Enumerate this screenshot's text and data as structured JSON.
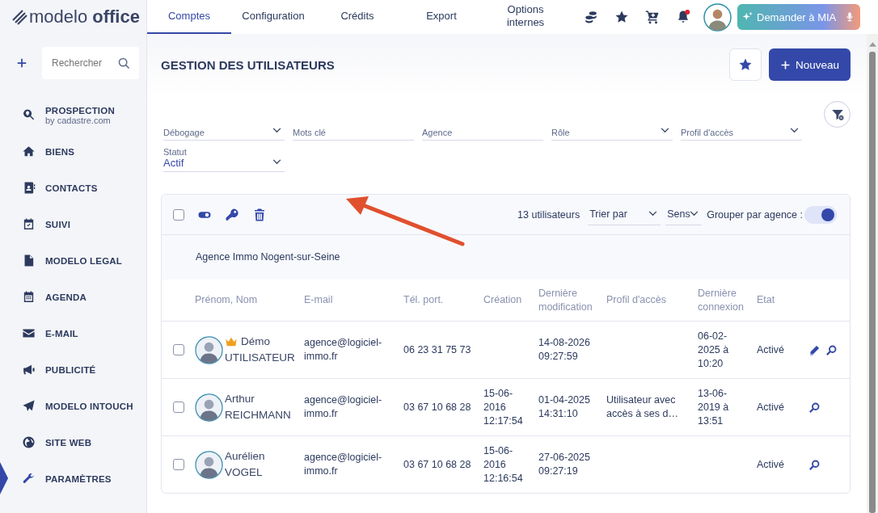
{
  "logo": {
    "text_light": "modelo",
    "text_bold": "office"
  },
  "tabs": [
    {
      "label": "Comptes",
      "selected": true
    },
    {
      "label": "Configuration",
      "selected": false
    },
    {
      "label": "Crédits",
      "selected": false
    },
    {
      "label": "Export",
      "selected": false
    },
    {
      "label": "Options internes",
      "selected": false
    }
  ],
  "notifications": {
    "unread": true
  },
  "ai_button": {
    "label": "Demander à MIA"
  },
  "sidebar": {
    "search": {
      "placeholder": "Rechercher"
    },
    "items": [
      {
        "label": "PROSPECTION",
        "sublabel": "by cadastre.com",
        "selected": false
      },
      {
        "label": "BIENS",
        "selected": false
      },
      {
        "label": "CONTACTS",
        "selected": false
      },
      {
        "label": "SUIVI",
        "selected": false
      },
      {
        "label": "MODELO LEGAL",
        "selected": false
      },
      {
        "label": "AGENDA",
        "selected": false
      },
      {
        "label": "E-MAIL",
        "selected": false
      },
      {
        "label": "PUBLICITÉ",
        "selected": false
      },
      {
        "label": "MODELO INTOUCH",
        "selected": false
      },
      {
        "label": "SITE WEB",
        "selected": false
      },
      {
        "label": "PARAMÈTRES",
        "selected": true
      }
    ]
  },
  "page": {
    "title": "GESTION DES UTILISATEURS",
    "new_button": "Nouveau"
  },
  "filters": [
    {
      "label": "Débogage",
      "kind": "select"
    },
    {
      "label": "Mots clé",
      "kind": "text"
    },
    {
      "label": "Agence",
      "kind": "text"
    },
    {
      "label": "Rôle",
      "kind": "select"
    },
    {
      "label": "Profil d'accès",
      "kind": "select"
    },
    {
      "label": "Statut",
      "kind": "select",
      "value": "Actif"
    }
  ],
  "toolbar": {
    "select_all": {
      "checked": false
    },
    "count": "13 utilisateurs",
    "sort": {
      "placeholder": "Trier par"
    },
    "direction": {
      "placeholder": "Sens"
    },
    "group_label": "Grouper par agence :",
    "group_on": true
  },
  "table": {
    "group": "Agence Immo Nogent-sur-Seine",
    "columns": [
      "Prénom, Nom",
      "E-mail",
      "Tél. port.",
      "Création",
      "Dernière modification",
      "Profil d'accès",
      "Dernière connexion",
      "Etat"
    ],
    "rows": [
      {
        "checked": false,
        "owner": true,
        "first": "Démo",
        "last": "UTILISATEUR",
        "email": "agence@logiciel-immo.fr",
        "phone": "06 23 31 75 73",
        "created": "",
        "modified": "14-08-2026 09:27:59",
        "profile": "",
        "login": "06-02-2025 à 10:20",
        "state": "Activé",
        "editable": true
      },
      {
        "checked": false,
        "owner": false,
        "first": "Arthur",
        "last": "REICHMANN",
        "email": "agence@logiciel-immo.fr",
        "phone": "03 67 10 68 28",
        "created": "15-06-2016 12:17:54",
        "modified": "01-04-2025 14:31:10",
        "profile": "Utilisateur avec accès à ses d…",
        "login": "13-06-2019 à 13:51",
        "state": "Activé",
        "editable": false
      },
      {
        "checked": false,
        "owner": false,
        "first": "Aurélien",
        "last": "VOGEL",
        "email": "agence@logiciel-immo.fr",
        "phone": "03 67 10 68 28",
        "created": "15-06-2016 12:16:54",
        "modified": "27-06-2025 09:27:19",
        "profile": "",
        "login": "",
        "state": "Activé",
        "editable": false
      }
    ]
  }
}
